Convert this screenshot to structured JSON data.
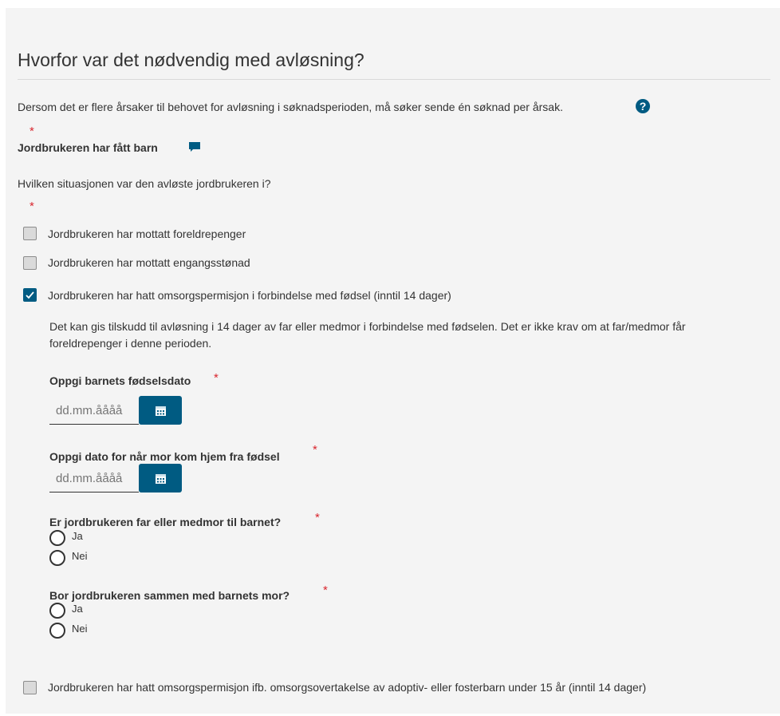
{
  "section": {
    "title": "Hvorfor var det nødvendig med avløsning?",
    "intro": "Dersom det er flere årsaker til behovet for avløsning i søknadsperioden, må søker sende én søknad per årsak.",
    "required_mark": "*"
  },
  "reason": {
    "label": "Jordbrukeren har fått barn"
  },
  "situation": {
    "question": "Hvilken situasjonen var den avløste jordbrukeren i?",
    "options": [
      {
        "label": "Jordbrukeren har mottatt foreldrepenger",
        "checked": false
      },
      {
        "label": "Jordbrukeren har mottatt engangsstønad",
        "checked": false
      },
      {
        "label": "Jordbrukeren har hatt omsorgspermisjon i forbindelse med fødsel (inntil 14 dager)",
        "checked": true
      },
      {
        "label": "Jordbrukeren har hatt omsorgspermisjon ifb. omsorgsovertakelse av adoptiv- eller fosterbarn under 15 år (inntil 14 dager)",
        "checked": false
      }
    ]
  },
  "details": {
    "info_line1": "Det kan gis tilskudd til avløsning i 14 dager av far eller medmor i forbindelse med fødselen. Det er ikke krav om at far/medmor får",
    "info_line2": "foreldrepenger i denne perioden.",
    "birth_date": {
      "label": "Oppgi barnets fødselsdato",
      "placeholder": "dd.mm.åååå",
      "value": ""
    },
    "home_date": {
      "label": "Oppgi dato for når mor kom hjem fra fødsel",
      "placeholder": "dd.mm.åååå",
      "value": ""
    },
    "father_q": {
      "label": "Er jordbrukeren far eller medmor til barnet?",
      "yes": "Ja",
      "no": "Nei"
    },
    "cohabit_q": {
      "label": "Bor jordbrukeren sammen med barnets mor?",
      "yes": "Ja",
      "no": "Nei"
    }
  },
  "colors": {
    "accent": "#005b82",
    "required": "#d9262e",
    "panel": "#f4f4f4"
  },
  "icons": {
    "help": "question-circle-icon",
    "comment": "comment-icon",
    "calendar": "calendar-icon",
    "check": "checkmark-icon"
  }
}
